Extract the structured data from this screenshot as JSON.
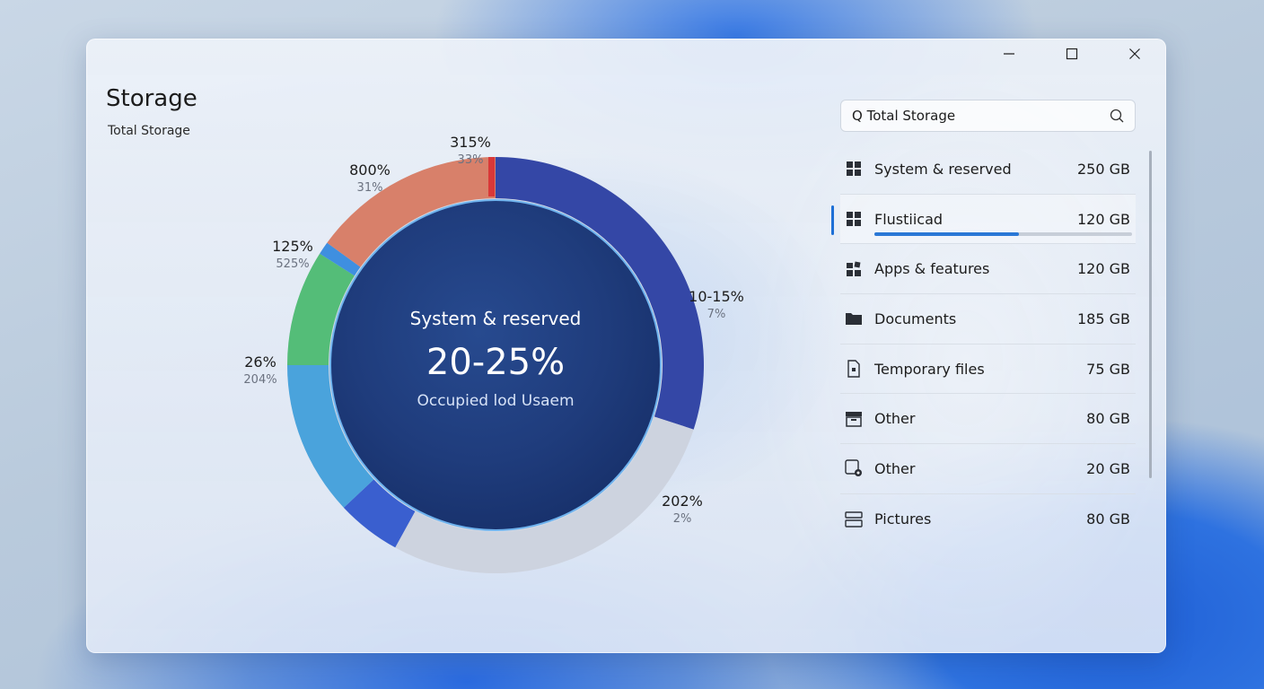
{
  "window": {
    "title": "Storage",
    "subtitle": "Total Storage",
    "controls": [
      "minimize-icon",
      "maximize-icon",
      "close-icon"
    ]
  },
  "search": {
    "value": "Q Total Storage"
  },
  "chart_data": {
    "type": "pie",
    "center": {
      "title": "System & reserved",
      "value": "20-25%",
      "caption": "Occupied lod Usaem"
    },
    "segments": [
      {
        "pct": "10-15%",
        "sub": "7%",
        "color": "#3447a6",
        "share": 0.3
      },
      {
        "pct": "202%",
        "sub": "2%",
        "color": "#cdd3df",
        "share": 0.28
      },
      {
        "pct": "",
        "sub": "",
        "color": "#3a5fcf",
        "share": 0.05
      },
      {
        "pct": "26%",
        "sub": "204%",
        "color": "#4aa3dc",
        "share": 0.12
      },
      {
        "pct": "125%",
        "sub": "525%",
        "color": "#54bd78",
        "share": 0.09
      },
      {
        "pct": "800%",
        "sub": "31%",
        "color": "#3f8fe0",
        "share": 0.01
      },
      {
        "pct": "315%",
        "sub": "33%",
        "color": "#d8806a",
        "share": 0.15
      }
    ]
  },
  "list": {
    "items": [
      {
        "name": "System & reserved",
        "size": "250 GB",
        "icon": "windows-icon"
      },
      {
        "name": "Flustiicad",
        "size": "120 GB",
        "icon": "windows-icon",
        "selected": true,
        "usage": 0.56
      },
      {
        "name": "Apps & features",
        "size": "120 GB",
        "icon": "apps-icon"
      },
      {
        "name": "Documents",
        "size": "185 GB",
        "icon": "folder-icon"
      },
      {
        "name": "Temporary files",
        "size": "75 GB",
        "icon": "file-icon"
      },
      {
        "name": "Other",
        "size": "80 GB",
        "icon": "archive-icon"
      },
      {
        "name": "Other",
        "size": "20 GB",
        "icon": "image-settings-icon"
      },
      {
        "name": "Pictures",
        "size": "80 GB",
        "icon": "pictures-icon"
      }
    ]
  },
  "colors": {
    "accent": "#1d6fd6",
    "center_fill": "#1e3a78"
  }
}
